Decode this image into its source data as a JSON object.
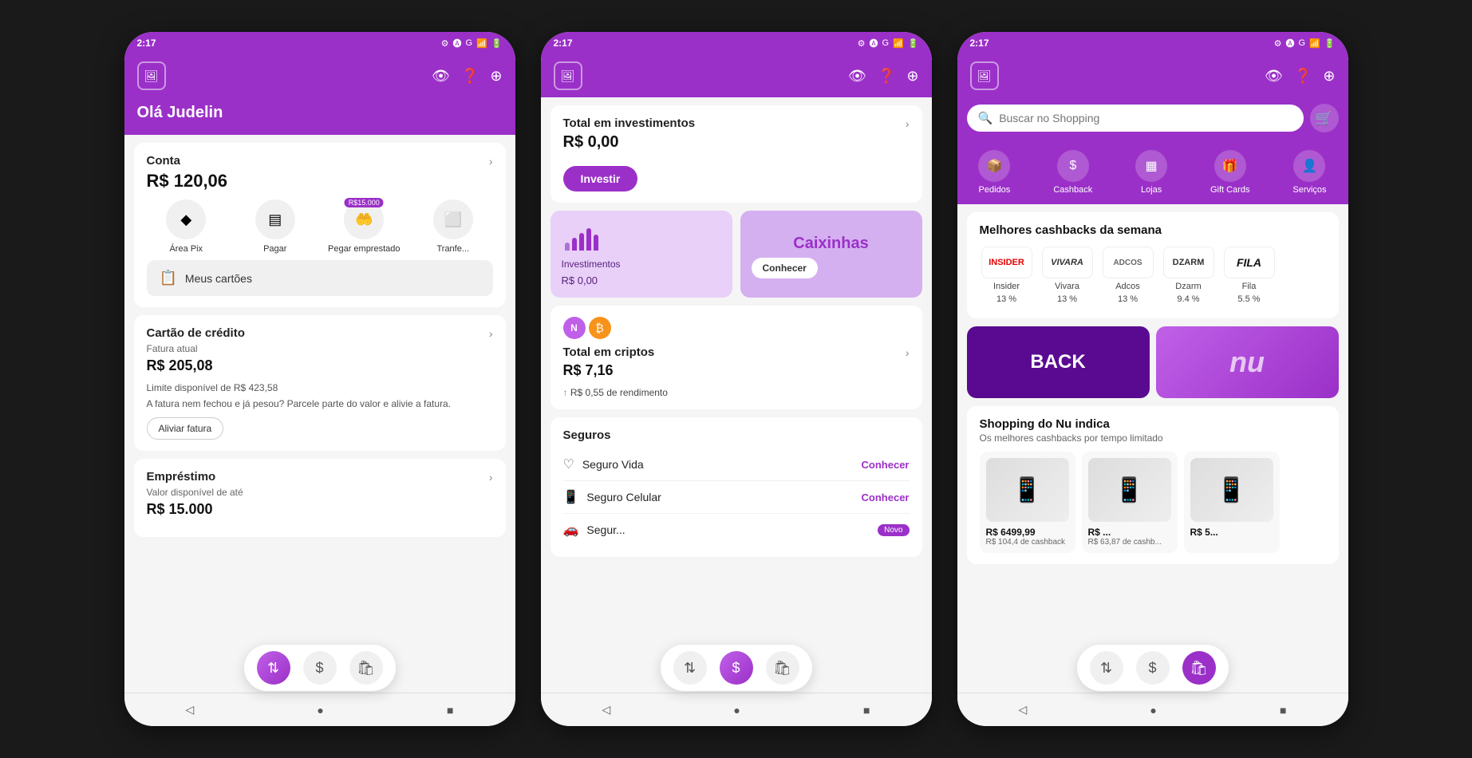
{
  "app": {
    "time": "2:17",
    "logo_symbol": "🖼",
    "status_icons": [
      "⚙",
      "🅐",
      "G",
      "📶",
      "🔋"
    ]
  },
  "phone1": {
    "greeting": "Olá Judelin",
    "conta": {
      "label": "Conta",
      "value": "R$ 120,06"
    },
    "quick_actions": [
      {
        "id": "pix",
        "icon": "◆",
        "label": "Área Pix"
      },
      {
        "id": "pagar",
        "icon": "▤",
        "label": "Pagar"
      },
      {
        "id": "emprestado",
        "icon": "🤲",
        "label": "Pegar emprestado",
        "badge": "R$15.000"
      },
      {
        "id": "transferir",
        "icon": "⬜",
        "label": "Tranfe..."
      }
    ],
    "meus_cartoes": "Meus cartões",
    "cartao_credito": {
      "label": "Cartão de crédito",
      "fatura_label": "Fatura atual",
      "fatura_value": "R$ 205,08",
      "limite_text": "Limite disponível de R$ 423,58",
      "parcela_text": "A fatura nem fechou e já pesou? Parcele parte do valor e alivie a fatura.",
      "aliviar_btn": "Aliviar fatura"
    },
    "emprestimo": {
      "label": "Empréstimo",
      "disponivel_label": "Valor disponível de até",
      "disponivel_value": "R$ 15.000"
    },
    "nav_buttons": [
      {
        "id": "transfer",
        "icon": "⇅",
        "active": true
      },
      {
        "id": "dollar",
        "icon": "$"
      },
      {
        "id": "bag",
        "icon": "🛍"
      }
    ]
  },
  "phone2": {
    "investimentos": {
      "label": "Total em investimentos",
      "value": "R$ 0,00",
      "investir_btn": "Investir"
    },
    "invest_cards": [
      {
        "label": "Investimentos",
        "value": "R$ 0,00",
        "type": "chart"
      },
      {
        "label": "Caixinhas",
        "conhecer_btn": "Conhecer",
        "type": "caixinhas"
      }
    ],
    "criptos": {
      "label": "Total em criptos",
      "value": "R$ 7,16",
      "rendimento": "R$ 0,55 de rendimento"
    },
    "seguros": {
      "label": "Seguros",
      "items": [
        {
          "icon": "♡",
          "name": "Seguro Vida",
          "action": "Conhecer"
        },
        {
          "icon": "📱",
          "name": "Seguro Celular",
          "action": "Conhecer"
        },
        {
          "icon": "🚗",
          "name": "Segur...",
          "action": "",
          "badge": "Novo"
        }
      ]
    },
    "nav_buttons": [
      {
        "id": "transfer",
        "icon": "⇅"
      },
      {
        "id": "dollar",
        "icon": "$",
        "active": true
      },
      {
        "id": "bag",
        "icon": "🛍"
      }
    ]
  },
  "phone3": {
    "search_placeholder": "Buscar no Shopping",
    "shopping_nav": [
      {
        "id": "pedidos",
        "icon": "📦",
        "label": "Pedidos"
      },
      {
        "id": "cashback",
        "icon": "$",
        "label": "Cashback"
      },
      {
        "id": "lojas",
        "icon": "▦",
        "label": "Lojas"
      },
      {
        "id": "gift_cards",
        "icon": "🎁",
        "label": "Gift Cards"
      },
      {
        "id": "servicos",
        "icon": "👤",
        "label": "Serviços"
      }
    ],
    "melhores_cashbacks": {
      "title": "Melhores cashbacks da semana",
      "brands": [
        {
          "name": "Insider",
          "pct": "13 %",
          "color": "#e60000"
        },
        {
          "name": "Vivara",
          "pct": "13 %",
          "color": "#333"
        },
        {
          "name": "Adcos",
          "pct": "13 %",
          "color": "#888"
        },
        {
          "name": "Dzarm",
          "pct": "9.4 %",
          "color": "#333"
        },
        {
          "name": "Fila",
          "pct": "5.5 %",
          "color": "#111"
        }
      ]
    },
    "promo_banners": [
      {
        "text": "BACK",
        "bg": "#6a10a0"
      },
      {
        "text": "nu",
        "bg": "linear-gradient(135deg,#c060e8,#9b30c8)"
      }
    ],
    "shopping_indica": {
      "title": "Shopping do Nu indica",
      "subtitle": "Os melhores cashbacks por tempo limitado"
    },
    "products": [
      {
        "emoji": "📱",
        "price": "R$ 6499,99",
        "cashback": "R$ 104,4 de cashback"
      },
      {
        "emoji": "📱",
        "price": "R$ ...",
        "cashback": "R$ 63,87 de cashb..."
      },
      {
        "emoji": "📱",
        "price": "R$ 5...",
        "cashback": ""
      }
    ],
    "nav_buttons": [
      {
        "id": "transfer",
        "icon": "⇅"
      },
      {
        "id": "dollar",
        "icon": "$"
      },
      {
        "id": "bag",
        "icon": "🛍",
        "active": true
      }
    ]
  }
}
